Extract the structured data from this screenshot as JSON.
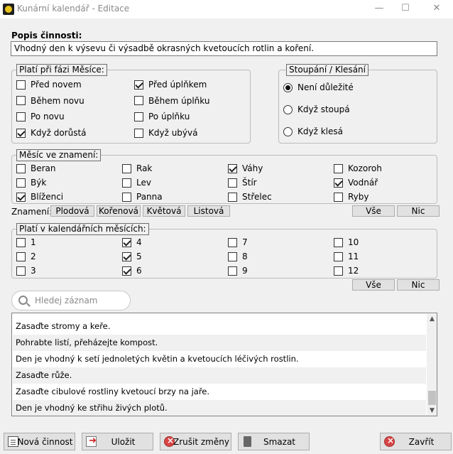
{
  "window": {
    "title": "Kunární kalendář - Editace"
  },
  "popis": {
    "label": "Popis činnosti:",
    "value": "Vhodný den k výsevu či výsadbě okrasných kvetoucích rotlin a koření."
  },
  "faze": {
    "legend": "Platí při fázi Měsíce:",
    "items": [
      {
        "label": "Před novem",
        "checked": false
      },
      {
        "label": "Během novu",
        "checked": false
      },
      {
        "label": "Po novu",
        "checked": false
      },
      {
        "label": "Když dorůstá",
        "checked": true
      },
      {
        "label": "Před úplňkem",
        "checked": true
      },
      {
        "label": "Během úplňku",
        "checked": false
      },
      {
        "label": "Po úplňku",
        "checked": false
      },
      {
        "label": "Když ubývá",
        "checked": false
      }
    ]
  },
  "stoupani": {
    "legend": "Stoupání / Klesání",
    "options": [
      {
        "label": "Není důležité",
        "selected": true
      },
      {
        "label": "Když stoupá",
        "selected": false
      },
      {
        "label": "Když klesá",
        "selected": false
      }
    ]
  },
  "znameni": {
    "legend": "Měsíc ve znamení:",
    "items": [
      {
        "label": "Beran",
        "checked": false
      },
      {
        "label": "Býk",
        "checked": false
      },
      {
        "label": "Blíženci",
        "checked": true
      },
      {
        "label": "Rak",
        "checked": false
      },
      {
        "label": "Lev",
        "checked": false
      },
      {
        "label": "Panna",
        "checked": false
      },
      {
        "label": "Váhy",
        "checked": true
      },
      {
        "label": "Štír",
        "checked": false
      },
      {
        "label": "Střelec",
        "checked": false
      },
      {
        "label": "Kozoroh",
        "checked": false
      },
      {
        "label": "Vodnář",
        "checked": true
      },
      {
        "label": "Ryby",
        "checked": false
      }
    ],
    "filter_label": "Znamení:",
    "filters": [
      "Plodová",
      "Kořenová",
      "Květová",
      "Listová"
    ],
    "all_label": "Vše",
    "none_label": "Nic"
  },
  "mesice": {
    "legend": "Platí v kalendářních měsících:",
    "items": [
      {
        "label": "1",
        "checked": false
      },
      {
        "label": "2",
        "checked": false
      },
      {
        "label": "3",
        "checked": false
      },
      {
        "label": "4",
        "checked": true
      },
      {
        "label": "5",
        "checked": true
      },
      {
        "label": "6",
        "checked": true
      },
      {
        "label": "7",
        "checked": false
      },
      {
        "label": "8",
        "checked": false
      },
      {
        "label": "9",
        "checked": false
      },
      {
        "label": "10",
        "checked": false
      },
      {
        "label": "11",
        "checked": false
      },
      {
        "label": "12",
        "checked": false
      }
    ],
    "all_label": "Vše",
    "none_label": "Nic"
  },
  "search": {
    "placeholder": "Hledej záznam"
  },
  "records": [
    "Zasaďte stromy a keře.",
    "Pohrabte listí, přeházejte kompost.",
    "Den je vhodný k setí jednoletých květin a kvetoucích léčivých rostlin.",
    "Zasaďte růže.",
    "Zasaďte cibulové rostliny kvetoucí brzy na jaře.",
    "Den je vhodný ke střihu živých plotů."
  ],
  "buttons": {
    "nova": "Nová činnost",
    "ulozit": "Uložit",
    "zrusit": "Zrušit změny",
    "smazat": "Smazat",
    "zavrit": "Zavřít"
  },
  "icons": {
    "app": "lunar-calendar-icon",
    "search": "search-icon",
    "new": "new-document-icon",
    "save": "save-icon",
    "cancel": "cancel-icon",
    "delete": "trash-icon",
    "close": "close-icon"
  }
}
